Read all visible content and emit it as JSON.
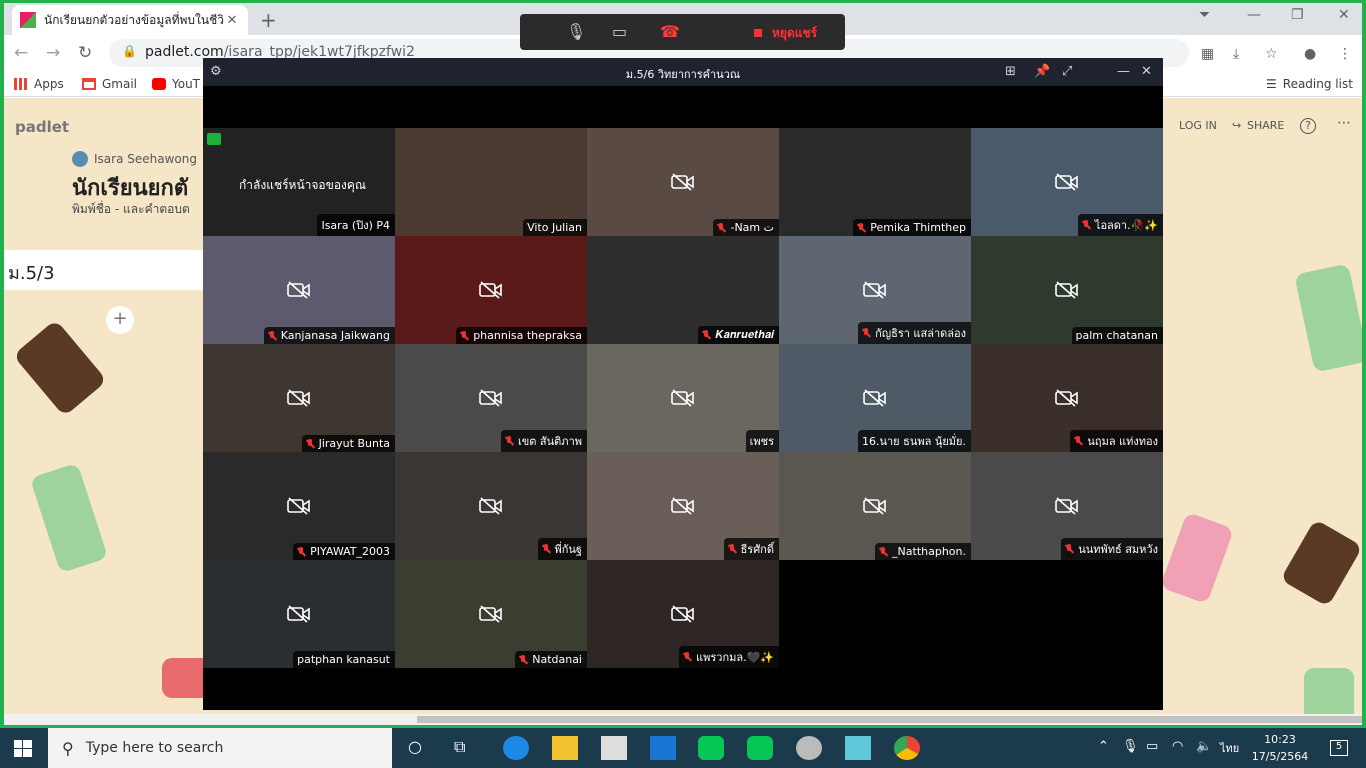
{
  "browser": {
    "tab_title": "นักเรียนยกตัวอย่างข้อมูลที่พบในชีวิตป",
    "url_host": "padlet.com",
    "url_path": "/isara_tpp/jek1wt7jfkpzfwi2",
    "bookmarks": [
      {
        "label": "Apps",
        "icon": "apps-icon"
      },
      {
        "label": "Gmail",
        "icon": "gmail-icon"
      },
      {
        "label": "YouT",
        "icon": "youtube-icon"
      }
    ],
    "reading_list": "Reading list"
  },
  "padlet": {
    "logo": "padlet",
    "author": "Isara Seehawong",
    "title": "นักเรียนยกตั",
    "subtitle": "พิมพ์ชื่อ - และคำตอบต",
    "column_title": "ม.5/3",
    "add_label": "+",
    "login_label": "LOG IN",
    "share_label": "SHARE",
    "help_label": "?",
    "more_label": "⋯",
    "colors": {
      "background": "#f5e6c8"
    }
  },
  "meet_bar": {
    "stop_share_label": "หยุดแชร์",
    "icons": [
      "mic-icon",
      "camera-off-icon",
      "hangup-icon",
      "stop-share-icon"
    ]
  },
  "meeting": {
    "title": "ม.5/6 วิทยาการคำนวณ",
    "sharing_text": "กำลังแชร์หน้าจอของคุณ",
    "self_name": "Isara (ปิง) P4",
    "participants": [
      {
        "name": "Vito Julian",
        "muted": false,
        "camera_off": false,
        "bg": "#4a3a32"
      },
      {
        "name": "-Nam ت",
        "muted": true,
        "camera_off": true,
        "bg": "#5a4a44"
      },
      {
        "name": "Pemika Thimthep",
        "muted": true,
        "camera_off": false,
        "bg": "#2a2a2a"
      },
      {
        "name": "ไอลดา.🥀✨",
        "muted": true,
        "camera_off": true,
        "bg": "#4a5a6a"
      },
      {
        "name": "Kanjanasa  Jaikwang",
        "muted": true,
        "camera_off": true,
        "bg": "#5d5a6e"
      },
      {
        "name": "phannisa thepraksa",
        "muted": true,
        "camera_off": true,
        "bg": "#5a1a1a"
      },
      {
        "name": "𝑲𝒂𝒏𝒓𝒖𝒆𝒕𝒉𝒂𝒊",
        "muted": true,
        "camera_off": false,
        "bg": "#2e2e2e"
      },
      {
        "name": "กัญธิรา แสล่าดล่อง",
        "muted": true,
        "camera_off": true,
        "bg": "#5e6672"
      },
      {
        "name": "palm chatanan",
        "muted": false,
        "camera_off": true,
        "bg": "#2e3a2e"
      },
      {
        "name": "Jirayut Bunta",
        "muted": true,
        "camera_off": true,
        "bg": "#3e3630"
      },
      {
        "name": "เขต สันติภาพ",
        "muted": true,
        "camera_off": true,
        "bg": "#4a4a4a"
      },
      {
        "name": "เพชร",
        "muted": false,
        "camera_off": true,
        "bg": "#6a6660"
      },
      {
        "name": "16.นาย ธนพล นุ้ยมั่ย.",
        "muted": false,
        "camera_off": true,
        "bg": "#4e5a66"
      },
      {
        "name": "นฤมล แท่งทอง",
        "muted": true,
        "camera_off": true,
        "bg": "#3a2e2a"
      },
      {
        "name": "PIYAWAT_2003",
        "muted": true,
        "camera_off": true,
        "bg": "#2a2a2a"
      },
      {
        "name": "พี่กันฐ",
        "muted": true,
        "camera_off": true,
        "bg": "#3a3634"
      },
      {
        "name": "ธีรศักดิ์",
        "muted": true,
        "camera_off": true,
        "bg": "#6a5e58"
      },
      {
        "name": "_Natthaphon.",
        "muted": true,
        "camera_off": true,
        "bg": "#5a5650"
      },
      {
        "name": "นนทพัทธ์ สมหวัง",
        "muted": true,
        "camera_off": true,
        "bg": "#4a4a4a"
      },
      {
        "name": "patphan kanasut",
        "muted": false,
        "camera_off": true,
        "bg": "#2a2e30"
      },
      {
        "name": "Natdanai",
        "muted": true,
        "camera_off": true,
        "bg": "#3a3e30"
      },
      {
        "name": "แพรวกมล.🖤✨",
        "muted": true,
        "camera_off": true,
        "bg": "#2e2624"
      }
    ]
  },
  "taskbar": {
    "search_placeholder": "Type here to search",
    "apps": [
      "task-view-icon",
      "edge-icon",
      "file-explorer-icon",
      "store-icon",
      "mail-icon",
      "line-icon",
      "line-icon",
      "media-icon",
      "app-icon",
      "chrome-icon"
    ],
    "language": "ไทย",
    "time": "10:23",
    "date": "17/5/2564",
    "notifications": "5"
  }
}
